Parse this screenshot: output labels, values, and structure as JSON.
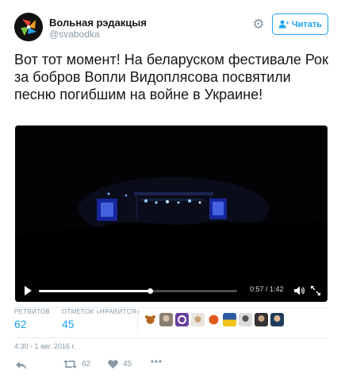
{
  "author": {
    "display_name": "Вольная рэдакцыя",
    "handle": "@svabodka",
    "brand_color": "#e8412b"
  },
  "header": {
    "settings_icon": "gear-icon",
    "follow_label": "Читать",
    "follow_icon": "add-user-icon",
    "accent_color": "#1da1f2"
  },
  "tweet": {
    "text": "Вот тот момент! На беларуском фестивале Рок за бобров Вопли Видоплясова посвятили песню погибшим на войне в Украине!"
  },
  "video": {
    "time": "0:57 / 1:42",
    "progress": 0.56,
    "play_icon": "play-icon",
    "volume_icon": "volume-icon",
    "fullscreen_icon": "fullscreen-icon"
  },
  "stats": {
    "retweets_label": "РЕТВИТОВ",
    "retweets_value": "62",
    "likes_label": "ОТМЕТОК «НРАВИТСЯ»",
    "likes_value": "45"
  },
  "timestamp": "4:30 - 1 авг. 2016 г.",
  "actions": {
    "reply_icon": "reply-icon",
    "retweet_icon": "retweet-icon",
    "retweet_count": "62",
    "like_icon": "heart-icon",
    "like_count": "45",
    "more_icon": "more-icon"
  }
}
